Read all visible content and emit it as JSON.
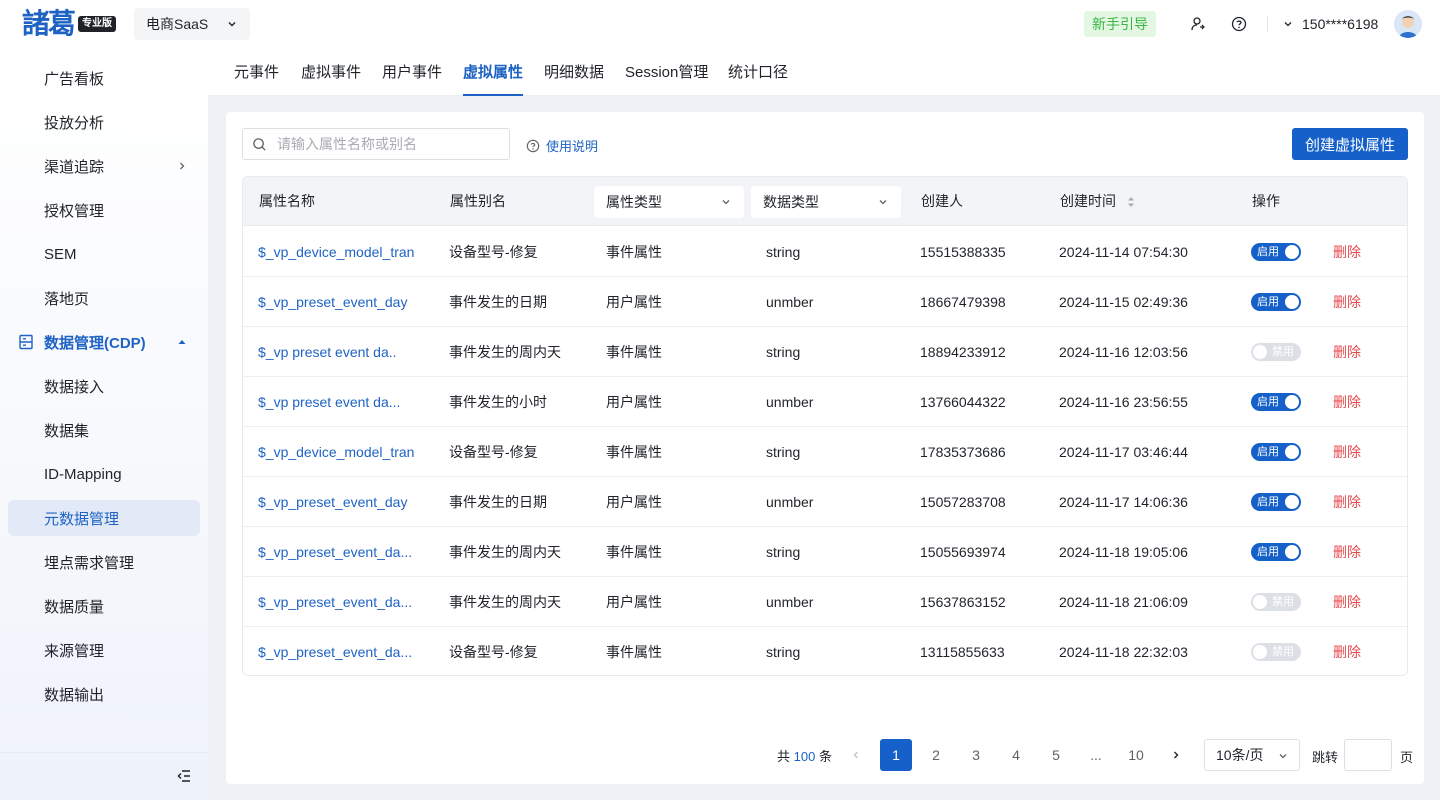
{
  "header": {
    "logo_text_1": "諸",
    "logo_text_2": "葛",
    "logo_badge": "专业版",
    "product": "电商SaaS",
    "guide_label": "新手引导",
    "user_phone": "150****6198"
  },
  "sidebar": {
    "items": [
      {
        "label": "广告看板"
      },
      {
        "label": "投放分析"
      },
      {
        "label": "渠道追踪"
      },
      {
        "label": "授权管理"
      },
      {
        "label": "SEM"
      },
      {
        "label": "落地页"
      },
      {
        "label": "数据管理(CDP)"
      },
      {
        "label": "数据接入"
      },
      {
        "label": "数据集"
      },
      {
        "label": "ID-Mapping"
      },
      {
        "label": "元数据管理"
      },
      {
        "label": "埋点需求管理"
      },
      {
        "label": "数据质量"
      },
      {
        "label": "来源管理"
      },
      {
        "label": "数据输出"
      }
    ]
  },
  "tabs": [
    {
      "label": "元事件"
    },
    {
      "label": "虚拟事件"
    },
    {
      "label": "用户事件"
    },
    {
      "label": "虚拟属性"
    },
    {
      "label": "明细数据"
    },
    {
      "label": "Session管理"
    },
    {
      "label": "统计口径"
    }
  ],
  "toolbar": {
    "search_placeholder": "请输入属性名称或别名",
    "help_label": "使用说明",
    "create_label": "创建虚拟属性"
  },
  "table": {
    "columns": {
      "name": "属性名称",
      "alias": "属性别名",
      "prop_type": "属性类型",
      "data_type": "数据类型",
      "creator": "创建人",
      "created_at": "创建时间",
      "actions": "操作"
    },
    "on_label": "启用",
    "off_label": "禁用",
    "delete_label": "删除",
    "rows": [
      {
        "name": "$_vp_device_model_tran",
        "alias": "设备型号-修复",
        "prop_type": "事件属性",
        "data_type": "string",
        "creator": "15515388335",
        "created_at": "2024-11-14 07:54:30",
        "enabled": true
      },
      {
        "name": "$_vp_preset_event_day",
        "alias": "事件发生的日期",
        "prop_type": "用户属性",
        "data_type": "unmber",
        "creator": "18667479398",
        "created_at": "2024-11-15 02:49:36",
        "enabled": true
      },
      {
        "name": "$_vp preset event da..",
        "alias": "事件发生的周内天",
        "prop_type": "事件属性",
        "data_type": "string",
        "creator": "18894233912",
        "created_at": "2024-11-16 12:03:56",
        "enabled": false
      },
      {
        "name": "$_vp preset event da...",
        "alias": "事件发生的小时",
        "prop_type": "用户属性",
        "data_type": "unmber",
        "creator": "13766044322",
        "created_at": "2024-11-16 23:56:55",
        "enabled": true
      },
      {
        "name": "$_vp_device_model_tran",
        "alias": "设备型号-修复",
        "prop_type": "事件属性",
        "data_type": "string",
        "creator": "17835373686",
        "created_at": "2024-11-17 03:46:44",
        "enabled": true
      },
      {
        "name": "$_vp_preset_event_day",
        "alias": "事件发生的日期",
        "prop_type": "用户属性",
        "data_type": "unmber",
        "creator": "15057283708",
        "created_at": "2024-11-17 14:06:36",
        "enabled": true
      },
      {
        "name": "$_vp_preset_event_da...",
        "alias": "事件发生的周内天",
        "prop_type": "事件属性",
        "data_type": "string",
        "creator": "15055693974",
        "created_at": "2024-11-18 19:05:06",
        "enabled": true
      },
      {
        "name": "$_vp_preset_event_da...",
        "alias": "事件发生的周内天",
        "prop_type": "用户属性",
        "data_type": "unmber",
        "creator": "15637863152",
        "created_at": "2024-11-18 21:06:09",
        "enabled": false
      },
      {
        "name": "$_vp_preset_event_da...",
        "alias": "设备型号-修复",
        "prop_type": "事件属性",
        "data_type": "string",
        "creator": "13115855633",
        "created_at": "2024-11-18 22:32:03",
        "enabled": false
      }
    ]
  },
  "pagination": {
    "total_prefix": "共",
    "total": "100",
    "total_suffix": "条",
    "pages": [
      "1",
      "2",
      "3",
      "4",
      "5",
      "...",
      "10"
    ],
    "current": "1",
    "page_size": "10条/页",
    "jump_label": "跳转",
    "jump_suffix": "页"
  },
  "colors": {
    "primary": "#1561c9",
    "link": "#1e63c4",
    "danger": "#e5484d",
    "guide_bg": "#e3f7e3",
    "guide_text": "#3bb346"
  }
}
